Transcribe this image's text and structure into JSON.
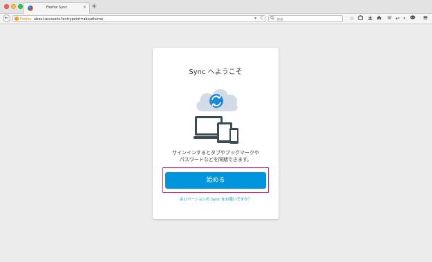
{
  "tab": {
    "title": "Firefox Sync",
    "close_symbol": "×",
    "new_tab_symbol": "+"
  },
  "navbar": {
    "back_symbol": "←",
    "identity_label": "Firefox",
    "url": "about:accounts?entrypoint=abouthome",
    "dropdown_symbol": "▾",
    "reload_symbol": "C",
    "search_placeholder": "検索"
  },
  "toolbar_icons": [
    "star-icon",
    "reading-list-icon",
    "download-icon",
    "home-icon",
    "pocket-icon",
    "share-icon",
    "chat-icon",
    "menu-icon"
  ],
  "card": {
    "title": "Sync へようこそ",
    "description_line1": "サインインするとタブやブックマークや",
    "description_line2": "パスワードなどを同期できます。",
    "start_button": "始める",
    "old_version_link": "古いバージョンの Sync をお使いですか？"
  },
  "colors": {
    "accent": "#0095dd",
    "highlight": "#e4217f",
    "background": "#ececec"
  }
}
